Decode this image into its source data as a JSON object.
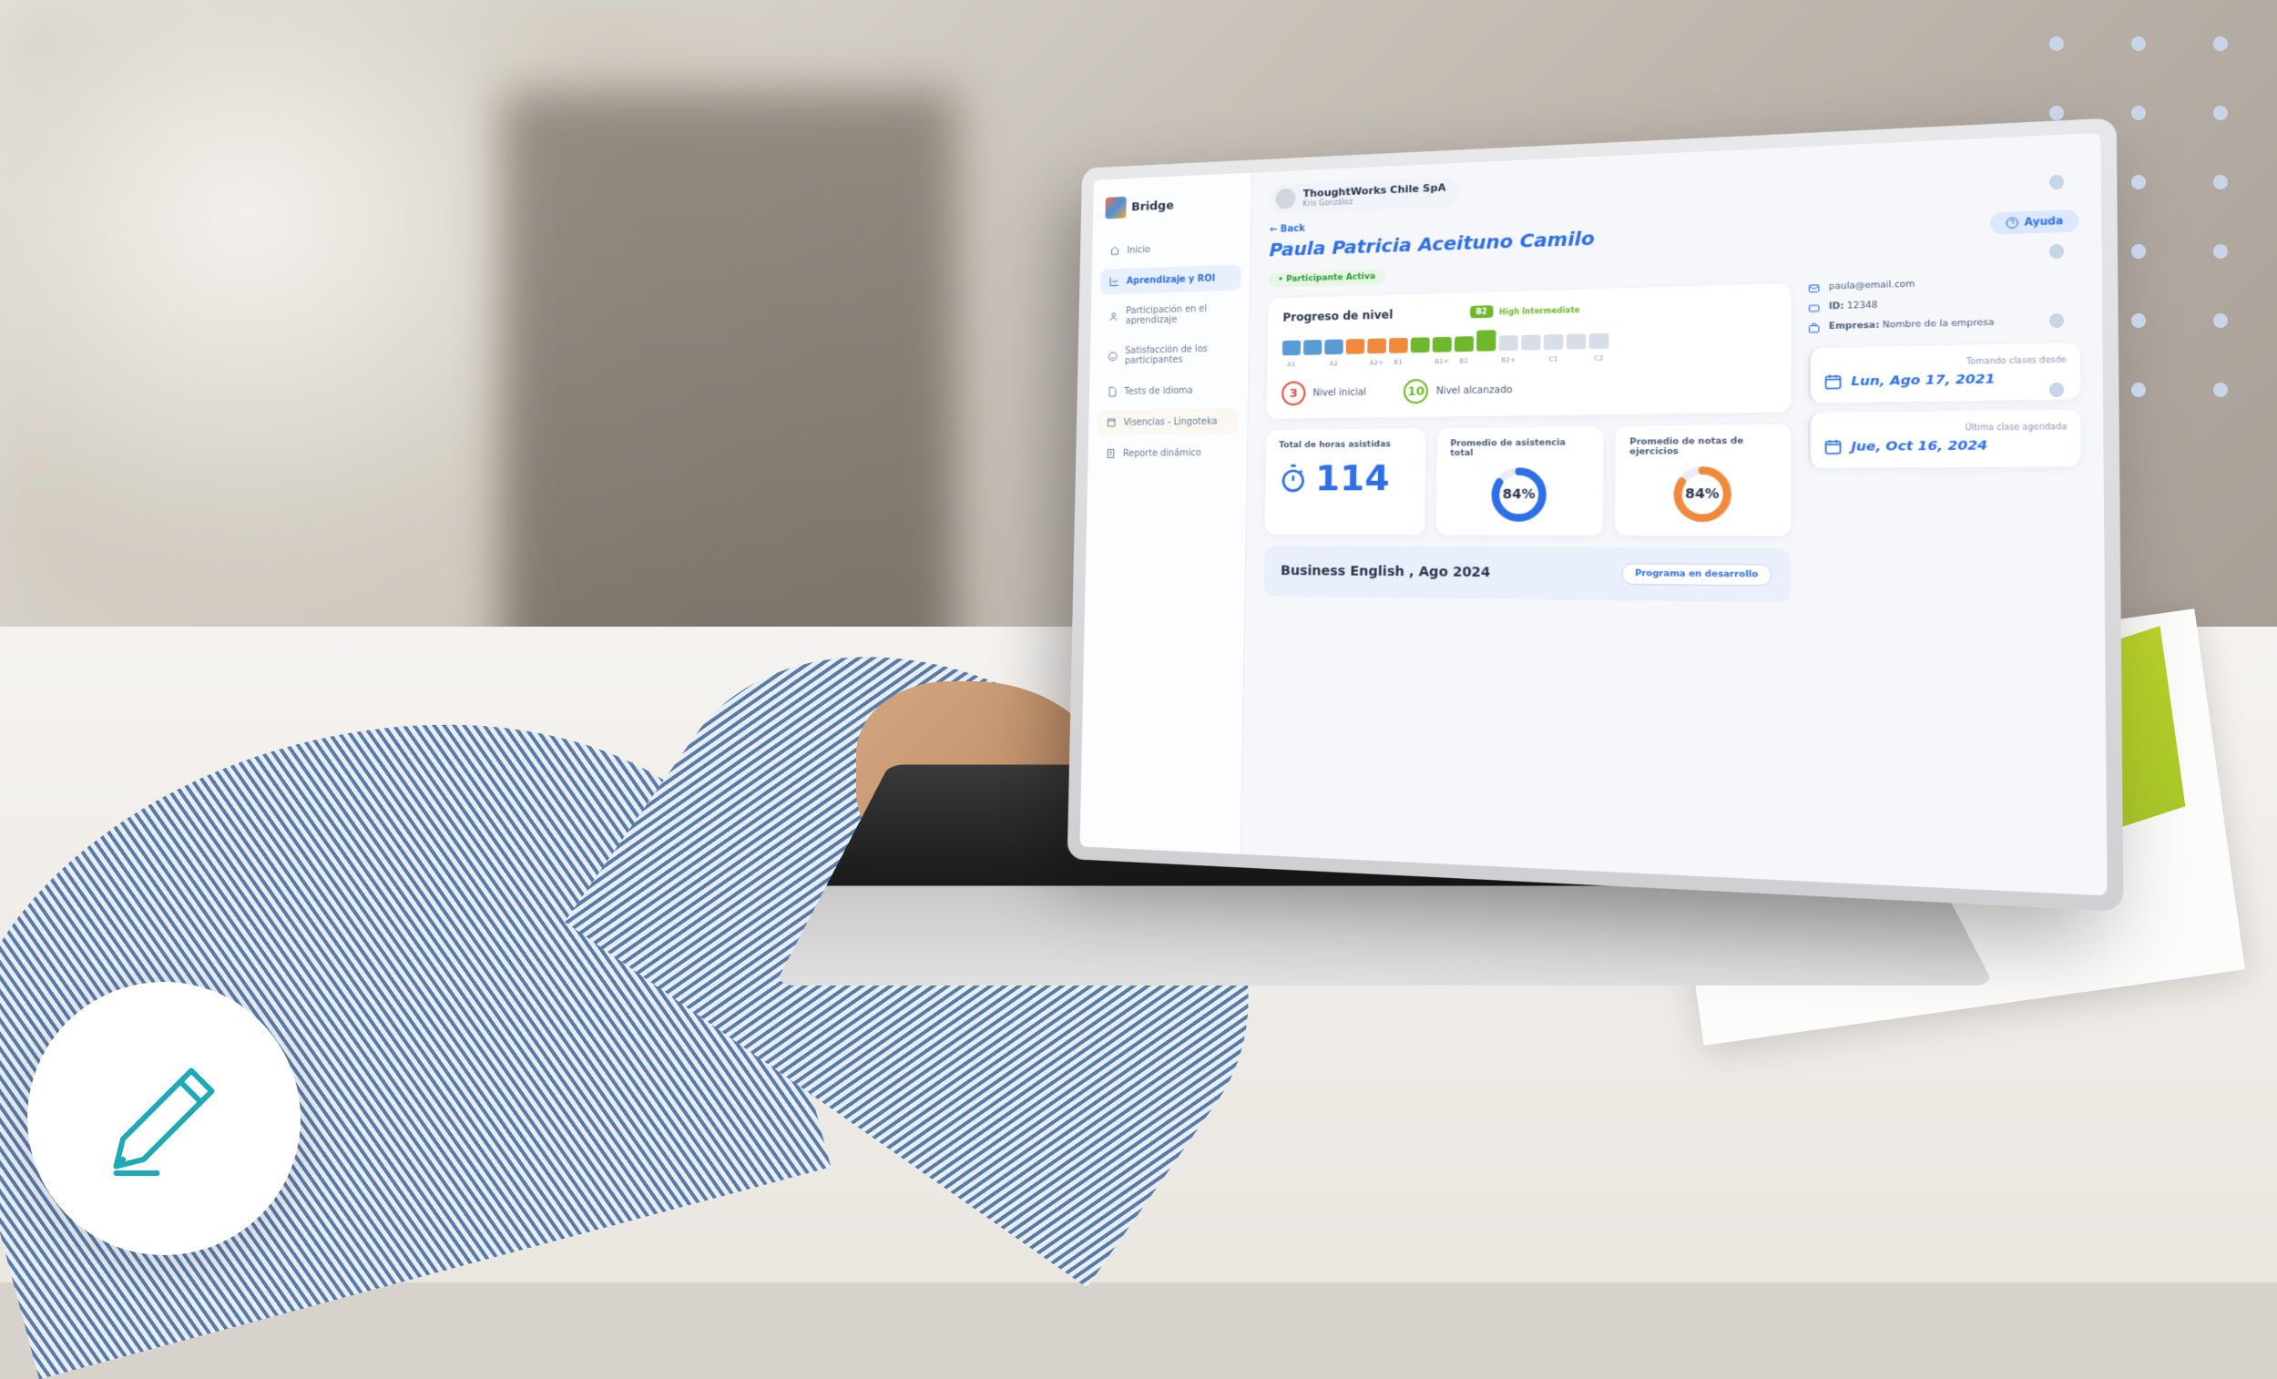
{
  "brand": "Bridge",
  "topbar": {
    "org": "ThoughtWorks Chile SpA",
    "user": "Kris González"
  },
  "sidebar": {
    "items": [
      {
        "label": "Inicio"
      },
      {
        "label": "Aprendizaje y ROI"
      },
      {
        "label": "Participación en el aprendizaje"
      },
      {
        "label": "Satisfacción de los participantes"
      },
      {
        "label": "Tests de idioma"
      },
      {
        "label": "Visencias - Lingoteka"
      },
      {
        "label": "Reporte dinámico"
      }
    ]
  },
  "page": {
    "back": "← Back",
    "title": "Paula Patricia Aceituno Camilo",
    "status": "• Participante Activa",
    "help": "Ayuda"
  },
  "contact": {
    "email": "paula@email.com",
    "id_label": "ID:",
    "id_value": "12348",
    "empresa_label": "Empresa:",
    "empresa_value": "Nombre de la empresa"
  },
  "progress": {
    "heading": "Progreso de nivel",
    "badge": "B2",
    "labels": [
      "A1",
      "A2",
      "A2+",
      "B1",
      "B1+",
      "B2",
      "B2+",
      "C1",
      "C2"
    ],
    "initial_label": "Nivel inicial",
    "initial_value": "3",
    "reached_label": "Nivel alcanzado",
    "reached_value": "10"
  },
  "dates": {
    "since_label": "Tomando clases desde",
    "since_value": "Lun, Ago 17, 2021",
    "last_label": "Última clase agendada",
    "last_value": "Jue, Oct 16, 2024"
  },
  "stats": {
    "hours_label": "Total de horas asistidas",
    "hours_value": "114",
    "attendance_label": "Promedio de asistencia total",
    "attendance_value": "84%",
    "grades_label": "Promedio de notas de ejercicios",
    "grades_value": "84%"
  },
  "program": {
    "title": "Business English , Ago 2024",
    "status": "Programa en desarrollo"
  }
}
